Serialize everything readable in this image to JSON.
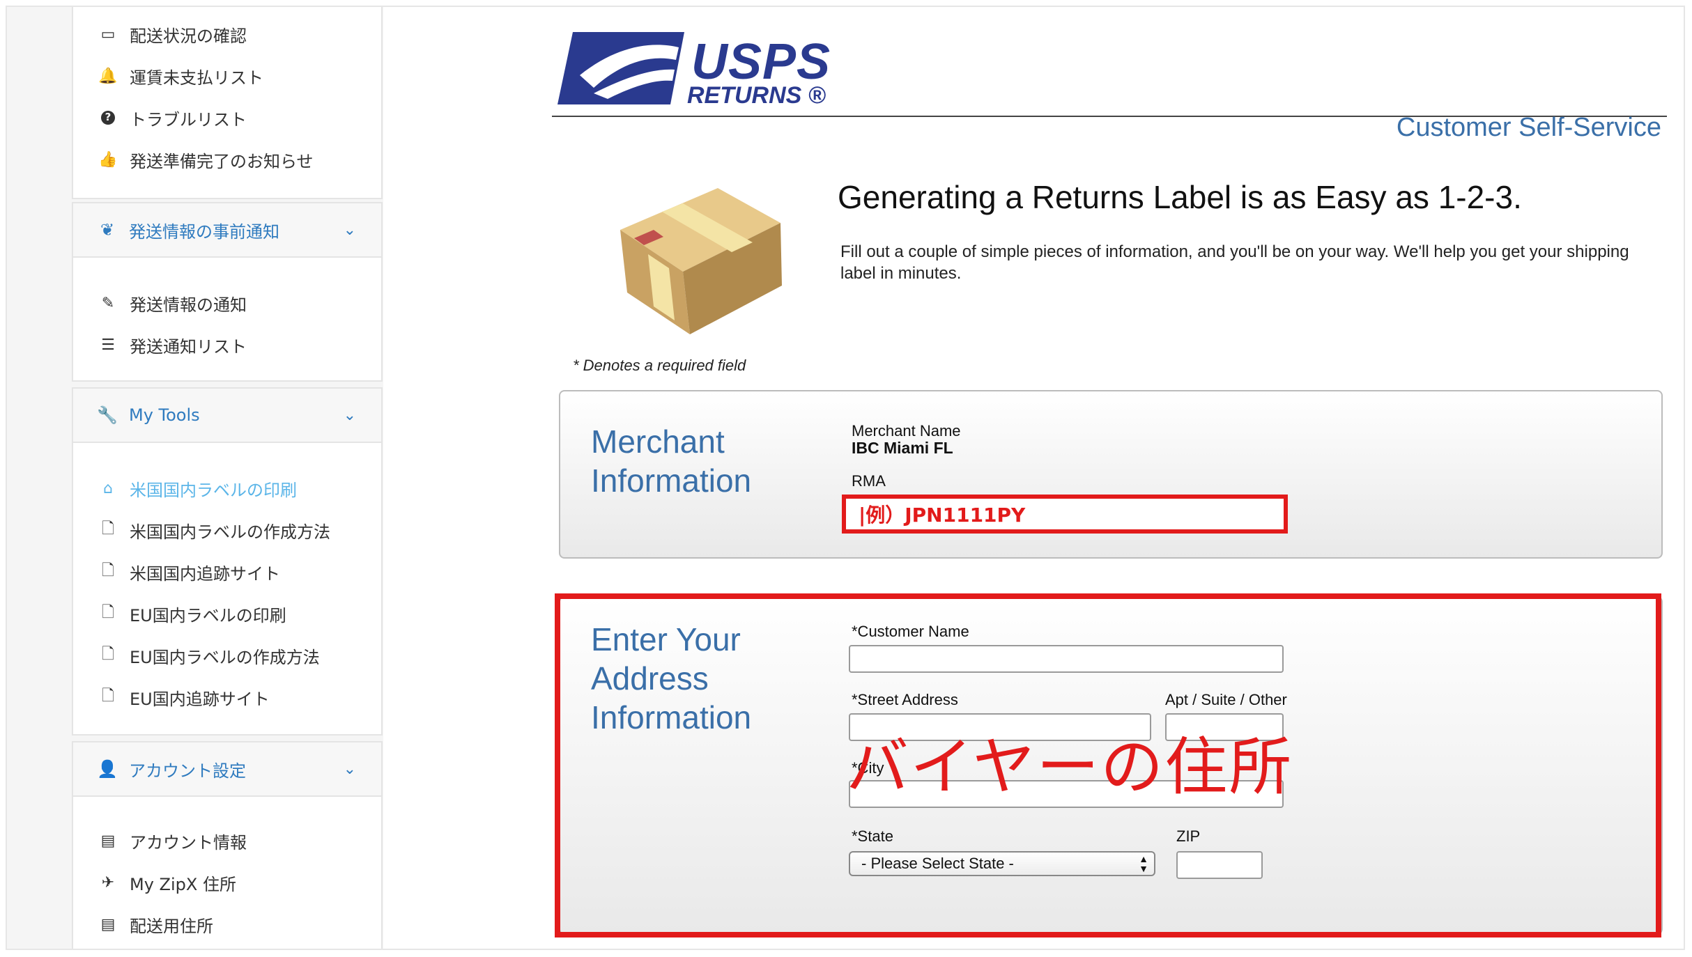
{
  "sidebar": {
    "group1_items": [
      {
        "icon": "monitor-icon",
        "glyph": "▭",
        "label": "配送状況の確認"
      },
      {
        "icon": "bell-icon",
        "glyph": "🔔",
        "label": "運賃未支払リスト"
      },
      {
        "icon": "question-circle-icon",
        "glyph": "?",
        "label": "トラブルリスト"
      },
      {
        "icon": "thumbs-up-icon",
        "glyph": "👍",
        "label": "発送準備完了のお知らせ"
      }
    ],
    "section_advance": {
      "label": "発送情報の事前通知",
      "icon": "leaf-icon"
    },
    "advance_items": [
      {
        "icon": "edit-icon",
        "glyph": "✎",
        "label": "発送情報の通知"
      },
      {
        "icon": "list-icon",
        "glyph": "☰",
        "label": "発送通知リスト"
      }
    ],
    "section_tools": {
      "label": "My Tools",
      "icon": "wrench-icon"
    },
    "tools_items": [
      {
        "icon": "home-icon",
        "glyph": "⌂",
        "label": "米国国内ラベルの印刷",
        "active": true
      },
      {
        "icon": "file-icon",
        "glyph": "🗋",
        "label": "米国国内ラベルの作成方法"
      },
      {
        "icon": "file-icon",
        "glyph": "🗋",
        "label": "米国国内追跡サイト"
      },
      {
        "icon": "file-icon",
        "glyph": "🗋",
        "label": "EU国内ラベルの印刷"
      },
      {
        "icon": "file-icon",
        "glyph": "🗋",
        "label": "EU国内ラベルの作成方法"
      },
      {
        "icon": "file-icon",
        "glyph": "🗋",
        "label": "EU国内追跡サイト"
      }
    ],
    "section_account": {
      "label": "アカウント設定",
      "icon": "user-icon"
    },
    "account_items": [
      {
        "icon": "document-icon",
        "glyph": "▤",
        "label": "アカウント情報"
      },
      {
        "icon": "plane-icon",
        "glyph": "✈",
        "label": "My ZipX 住所"
      },
      {
        "icon": "document-icon",
        "glyph": "▤",
        "label": "配送用住所"
      }
    ]
  },
  "header": {
    "logo_usps": "USPS",
    "logo_returns": "RETURNS ®",
    "self_service": "Customer Self-Service"
  },
  "intro": {
    "headline": "Generating a Returns Label is as Easy as 1-2-3.",
    "subtext": "Fill out a couple of simple pieces of information, and you'll be on your way. We'll help you get your shipping label in minutes.",
    "required_note": "* Denotes a required field"
  },
  "merchant": {
    "title": "Merchant\nInformation",
    "name_label": "Merchant Name",
    "name_value": "IBC Miami FL",
    "rma_label": "RMA",
    "rma_example": "|例）JPN1111PY"
  },
  "address": {
    "title": "Enter Your\nAddress\nInformation",
    "customer_name_label": "*Customer Name",
    "street_label": "*Street Address",
    "apt_label": "Apt / Suite / Other",
    "city_label": "*City",
    "state_label": "*State",
    "state_selected": "- Please Select State -",
    "zip_label": "ZIP",
    "overlay_annotation": "バイヤーの住所"
  },
  "colors": {
    "accent_blue": "#3a6fa8",
    "sidebar_link": "#2f7bbf",
    "active_link": "#5bb5e8",
    "annotation_red": "#e21b1b",
    "usps_navy": "#2a3a8f"
  }
}
